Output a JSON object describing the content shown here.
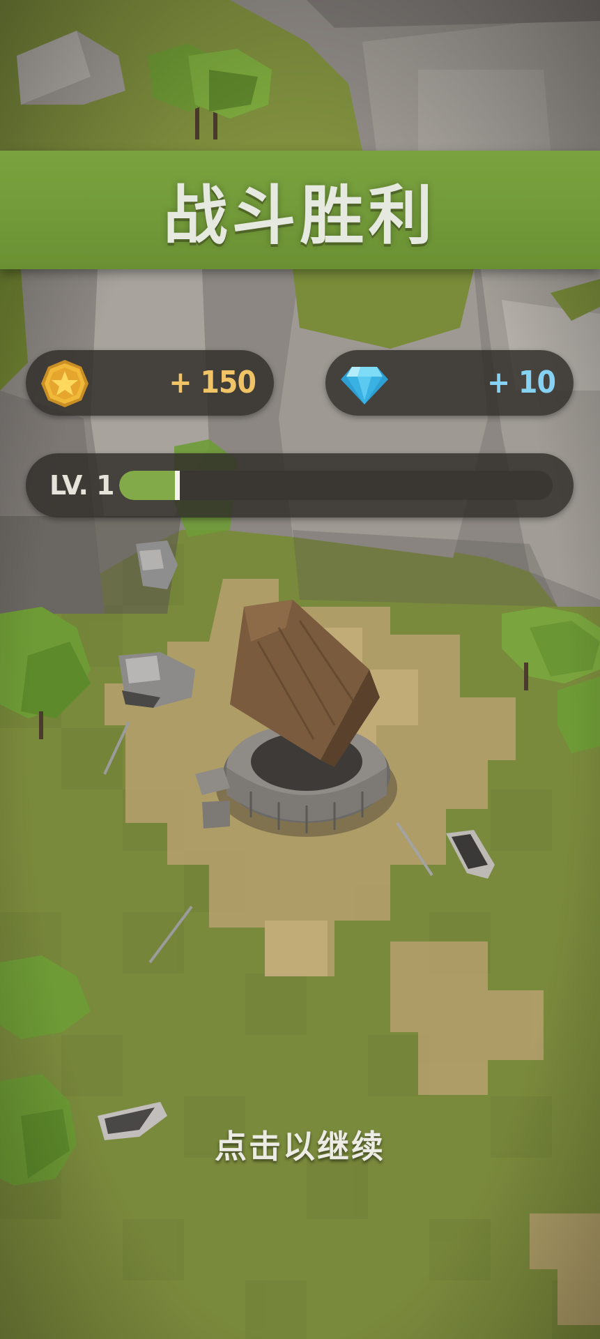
{
  "banner": {
    "title": "战斗胜利"
  },
  "rewards": {
    "gold": {
      "icon": "gold-coin-icon",
      "amount": "+ 150",
      "color": "#f0c466"
    },
    "gems": {
      "icon": "diamond-gem-icon",
      "amount": "+ 10",
      "color": "#86d2f4"
    }
  },
  "level": {
    "label": "LV. 1",
    "progress": 0.14,
    "bar_color": "#82aa48"
  },
  "prompt": {
    "continue_label": "点击以继续"
  },
  "scene": {
    "description_icons": [
      "well-icon",
      "knight-helmet-icon",
      "shield-icon",
      "sword-icon",
      "tree-icon",
      "rock-icon"
    ]
  },
  "colors": {
    "banner": "#7aa33f",
    "grass": "#7c8c3e",
    "dirt": "#b9a272"
  }
}
